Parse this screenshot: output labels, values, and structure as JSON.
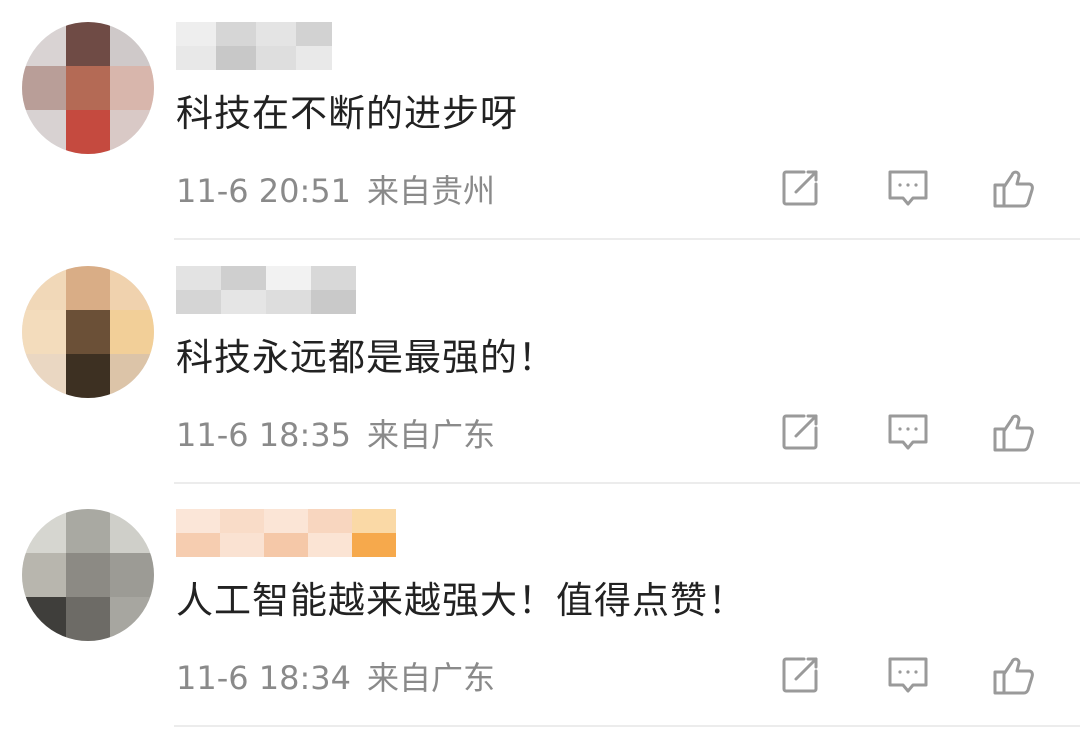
{
  "comments": [
    {
      "text": "科技在不断的进步呀",
      "time": "11-6 20:51",
      "location": "来自贵州"
    },
    {
      "text": "科技永远都是最强的！",
      "time": "11-6 18:35",
      "location": "来自广东"
    },
    {
      "text": "人工智能越来越强大！值得点赞！",
      "time": "11-6 18:34",
      "location": "来自广东"
    }
  ],
  "icons": {
    "share": "share-icon",
    "comment": "comment-icon",
    "like": "thumbs-up-icon"
  },
  "colors": {
    "text": "#222222",
    "meta": "#8a8a8a",
    "icon": "#9a9a9a",
    "divider": "#ececec"
  }
}
